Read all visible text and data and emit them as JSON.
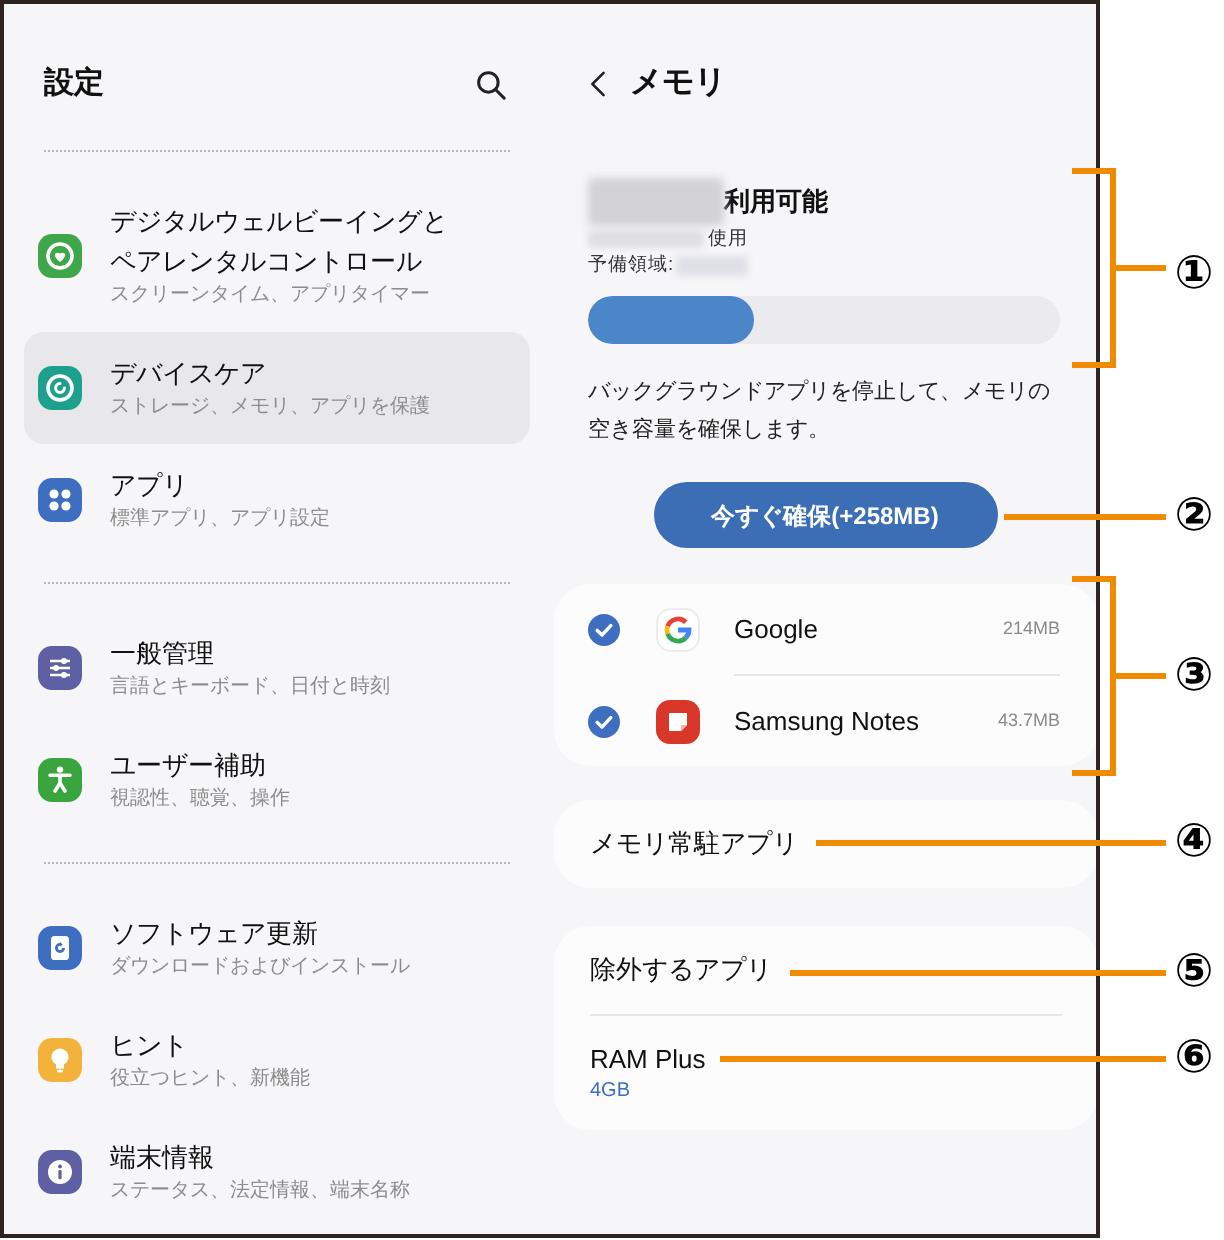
{
  "left_panel": {
    "title": "設定",
    "groups": [
      {
        "items": [
          {
            "title": "デジタルウェルビーイングとペアレンタルコントロール",
            "subtitle": "スクリーンタイム、アプリタイマー",
            "selected": false
          },
          {
            "title": "デバイスケア",
            "subtitle": "ストレージ、メモリ、アプリを保護",
            "selected": true
          },
          {
            "title": "アプリ",
            "subtitle": "標準アプリ、アプリ設定",
            "selected": false
          }
        ]
      },
      {
        "items": [
          {
            "title": "一般管理",
            "subtitle": "言語とキーボード、日付と時刻",
            "selected": false
          },
          {
            "title": "ユーザー補助",
            "subtitle": "視認性、聴覚、操作",
            "selected": false
          }
        ]
      },
      {
        "items": [
          {
            "title": "ソフトウェア更新",
            "subtitle": "ダウンロードおよびインストール",
            "selected": false
          },
          {
            "title": "ヒント",
            "subtitle": "役立つヒント、新機能",
            "selected": false
          },
          {
            "title": "端末情報",
            "subtitle": "ステータス、法定情報、端末名称",
            "selected": false
          }
        ]
      }
    ]
  },
  "right_panel": {
    "title": "メモリ",
    "memory": {
      "available_label": "利用可能",
      "used_label": "使用",
      "reserved_label": "予備領域:",
      "level": 0.35
    },
    "description": "バックグラウンドアプリを停止して、メモリの空き容量を確保します。",
    "free_button": "今すぐ確保(+258MB)",
    "apps": [
      {
        "name": "Google",
        "size": "214MB",
        "checked": true
      },
      {
        "name": "Samsung Notes",
        "size": "43.7MB",
        "checked": true
      }
    ],
    "menu_cards": [
      {
        "items": [
          {
            "label": "メモリ常駐アプリ"
          }
        ]
      },
      {
        "items": [
          {
            "label": "除外するアプリ"
          },
          {
            "label": "RAM Plus",
            "value": "4GB"
          }
        ]
      }
    ]
  },
  "callouts": [
    {
      "kind": "bracket",
      "label": "①"
    },
    {
      "kind": "line",
      "label": "②"
    },
    {
      "kind": "bracket",
      "label": "③"
    },
    {
      "kind": "line",
      "label": "④"
    },
    {
      "kind": "line",
      "label": "⑤"
    },
    {
      "kind": "line",
      "label": "⑥"
    }
  ]
}
